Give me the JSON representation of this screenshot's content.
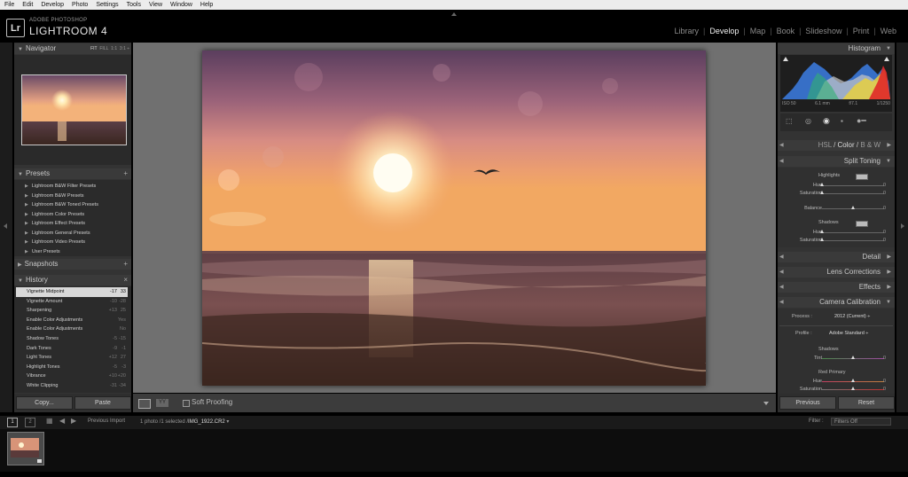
{
  "menu": [
    "File",
    "Edit",
    "Develop",
    "Photo",
    "Settings",
    "Tools",
    "View",
    "Window",
    "Help"
  ],
  "brand": {
    "logo": "Lr",
    "top": "ADOBE PHOTOSHOP",
    "main": "LIGHTROOM 4"
  },
  "modules": [
    {
      "label": "Library",
      "active": false
    },
    {
      "label": "Develop",
      "active": true
    },
    {
      "label": "Map",
      "active": false
    },
    {
      "label": "Book",
      "active": false
    },
    {
      "label": "Slideshow",
      "active": false
    },
    {
      "label": "Print",
      "active": false
    },
    {
      "label": "Web",
      "active": false
    }
  ],
  "navigator": {
    "title": "Navigator",
    "zoom": [
      "FIT",
      "FILL",
      "1:1",
      "3:1"
    ]
  },
  "presets": {
    "title": "Presets",
    "items": [
      "Lightroom B&W Filter Presets",
      "Lightroom B&W Presets",
      "Lightroom B&W Toned Presets",
      "Lightroom Color Presets",
      "Lightroom Effect Presets",
      "Lightroom General Presets",
      "Lightroom Video Presets",
      "User Presets"
    ]
  },
  "snapshots": {
    "title": "Snapshots"
  },
  "history": {
    "title": "History",
    "close": "×",
    "items": [
      {
        "label": "Vignette Midpoint",
        "v1": "-17",
        "v2": "33",
        "selected": true
      },
      {
        "label": "Vignette Amount",
        "v1": "-10",
        "v2": "-28",
        "selected": false
      },
      {
        "label": "Sharpening",
        "v1": "+13",
        "v2": "25",
        "selected": false
      },
      {
        "label": "Enable Color Adjustments",
        "v1": "",
        "v2": "Yes",
        "selected": false
      },
      {
        "label": "Enable Color Adjustments",
        "v1": "",
        "v2": "No",
        "selected": false
      },
      {
        "label": "Shadow Tones",
        "v1": "-5",
        "v2": "-15",
        "selected": false
      },
      {
        "label": "Dark Tones",
        "v1": "-9",
        "v2": "-1",
        "selected": false
      },
      {
        "label": "Light Tones",
        "v1": "+12",
        "v2": "27",
        "selected": false
      },
      {
        "label": "Highlight Tones",
        "v1": "-5",
        "v2": "-3",
        "selected": false
      },
      {
        "label": "Vibrance",
        "v1": "+10",
        "v2": "+20",
        "selected": false
      },
      {
        "label": "White Clipping",
        "v1": "-31",
        "v2": "-34",
        "selected": false
      }
    ]
  },
  "left_buttons": {
    "copy": "Copy...",
    "paste": "Paste"
  },
  "toolbar": {
    "soft_proofing": "Soft Proofing"
  },
  "histogram": {
    "title": "Histogram",
    "info": [
      "ISO 50",
      "6.1 mm",
      "f/7.1",
      "1/1250"
    ]
  },
  "hsl": {
    "hsl": "HSL",
    "color": "Color",
    "bw": "B & W"
  },
  "split_toning": {
    "title": "Split Toning",
    "highlights": "Highlights",
    "hue": "Hue",
    "saturation": "Saturation",
    "balance": "Balance",
    "shadows": "Shadows",
    "values": [
      "0",
      "0",
      "0",
      "0",
      "0"
    ]
  },
  "sections": [
    "Detail",
    "Lens Corrections",
    "Effects"
  ],
  "camera_calibration": {
    "title": "Camera Calibration",
    "process_label": "Process :",
    "process_value": "2012 (Current) ÷",
    "profile_label": "Profile :",
    "profile_value": "Adobe Standard ÷",
    "shadows": "Shadows",
    "tint": "Tint",
    "red_primary": "Red Primary",
    "hue": "Hue",
    "saturation": "Saturation",
    "values": [
      "0",
      "0",
      "0"
    ]
  },
  "right_buttons": {
    "previous": "Previous",
    "reset": "Reset"
  },
  "filmstrip": {
    "pages": [
      "1",
      "2"
    ],
    "source": "Previous Import",
    "count_prefix": "1 photo /1 selected /",
    "filename": "IMG_1922.CR2",
    "filter_label": "Filter :",
    "filter_value": "Filters Off"
  }
}
